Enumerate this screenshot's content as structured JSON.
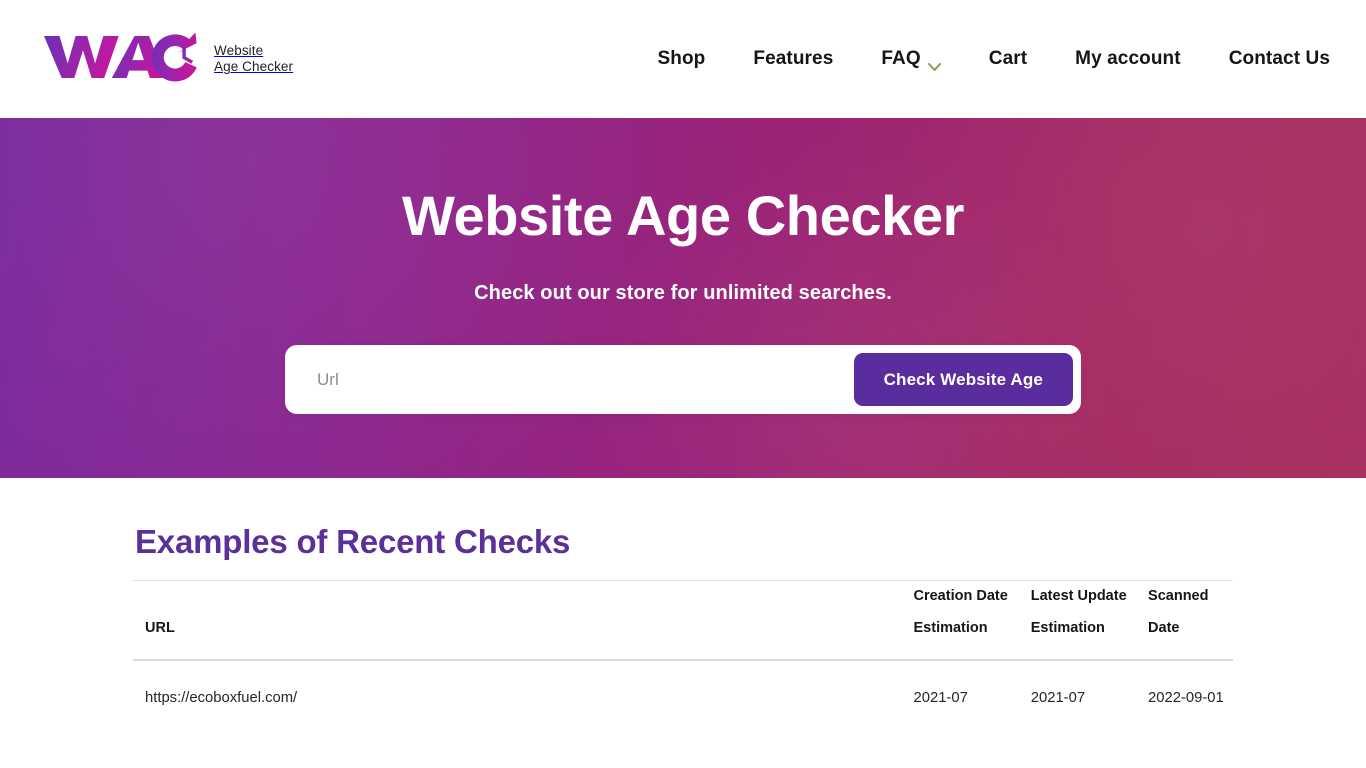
{
  "header": {
    "logo": {
      "mark_text": "WAC",
      "icon_name": "wac-clock-logo",
      "gradient_start": "#6b2fb5",
      "gradient_end": "#c4179f",
      "tagline_line1": "Website",
      "tagline_line2": "Age Checker"
    },
    "nav": [
      {
        "label": "Shop",
        "has_dropdown": false
      },
      {
        "label": "Features",
        "has_dropdown": false
      },
      {
        "label": "FAQ",
        "has_dropdown": true
      },
      {
        "label": "Cart",
        "has_dropdown": false
      },
      {
        "label": "My account",
        "has_dropdown": false
      },
      {
        "label": "Contact Us",
        "has_dropdown": false
      }
    ],
    "chevron_color": "#8a9a5b"
  },
  "hero": {
    "title": "Website Age Checker",
    "subtitle": "Check out our store for unlimited searches.",
    "gradient_left": "#7a2a9d",
    "gradient_mid": "#9b2377",
    "gradient_right": "#a93060",
    "search": {
      "input_value": "",
      "placeholder": "Url",
      "button_label": "Check Website Age",
      "button_color": "#5a2d9e"
    }
  },
  "examples": {
    "title": "Examples of Recent Checks",
    "title_color": "#5b3199",
    "columns": [
      "URL",
      "Creation Date Estimation",
      "Latest Update Estimation",
      "Scanned Date"
    ],
    "rows": [
      {
        "url": "https://ecoboxfuel.com/",
        "creation_date_estimation": "2021-07",
        "latest_update_estimation": "2021-07",
        "scanned_date": "2022-09-01"
      }
    ]
  }
}
